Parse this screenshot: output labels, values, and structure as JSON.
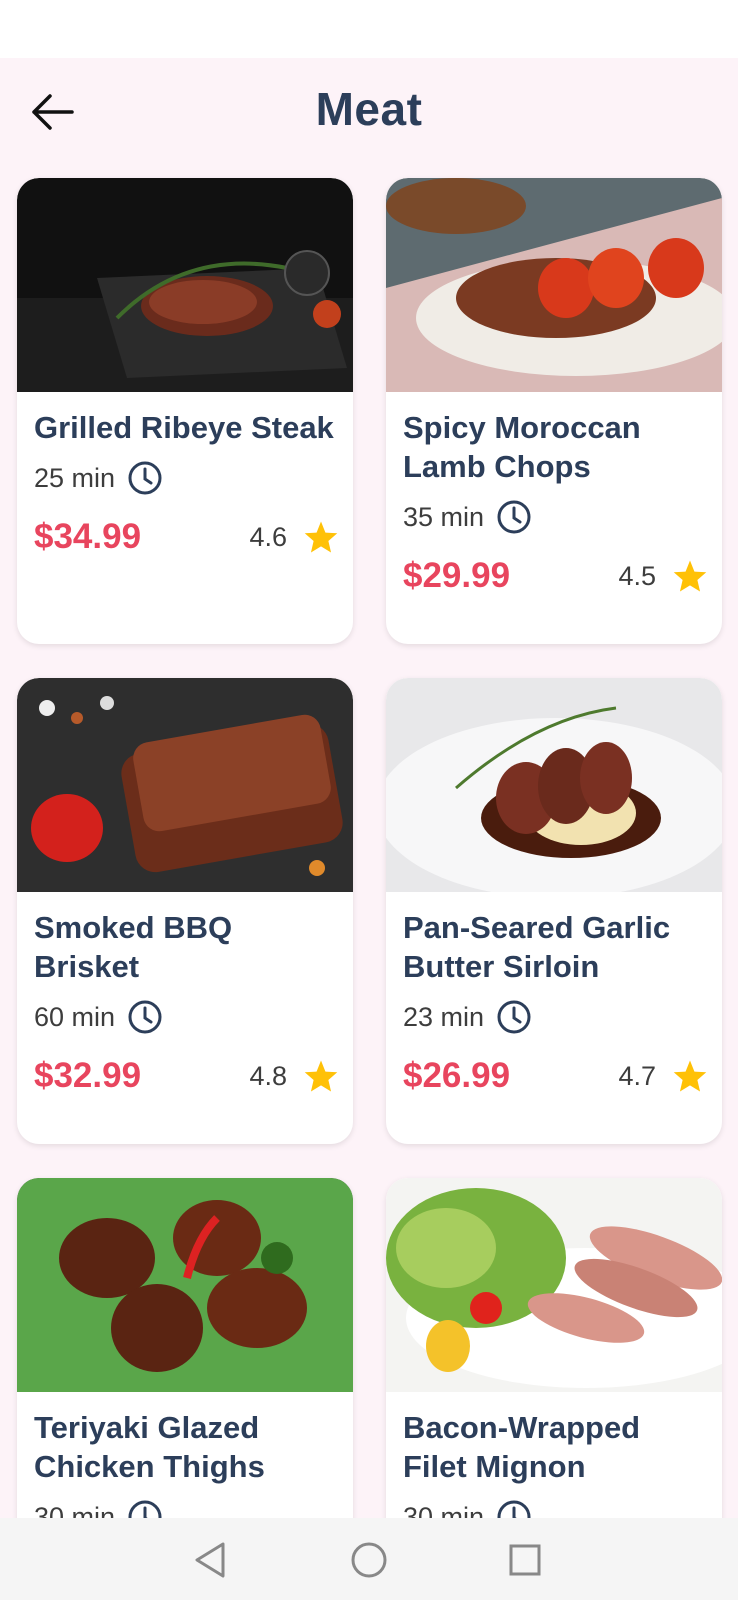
{
  "header": {
    "title": "Meat"
  },
  "icons": {
    "back": "arrow-left-icon",
    "clock": "clock-icon",
    "star": "star-icon"
  },
  "colors": {
    "title": "#2c3e5a",
    "price": "#e8455e",
    "star": "#ffc107",
    "background": "#fdf3f8"
  },
  "recipes": [
    {
      "name": "Grilled Ribeye Steak",
      "time": "25 min",
      "price": "$34.99",
      "rating": "4.6"
    },
    {
      "name": "Spicy Moroccan Lamb Chops",
      "time": "35 min",
      "price": "$29.99",
      "rating": "4.5"
    },
    {
      "name": "Smoked BBQ Brisket",
      "time": "60 min",
      "price": "$32.99",
      "rating": "4.8"
    },
    {
      "name": "Pan-Seared Garlic Butter Sirloin",
      "time": "23 min",
      "price": "$26.99",
      "rating": "4.7"
    },
    {
      "name": "Teriyaki Glazed Chicken Thighs",
      "time": "30 min",
      "price": "",
      "rating": ""
    },
    {
      "name": "Bacon-Wrapped Filet Mignon",
      "time": "30 min",
      "price": "",
      "rating": ""
    }
  ],
  "nav": {
    "back": "triangle-back-icon",
    "home": "circle-home-icon",
    "recents": "square-recents-icon"
  }
}
